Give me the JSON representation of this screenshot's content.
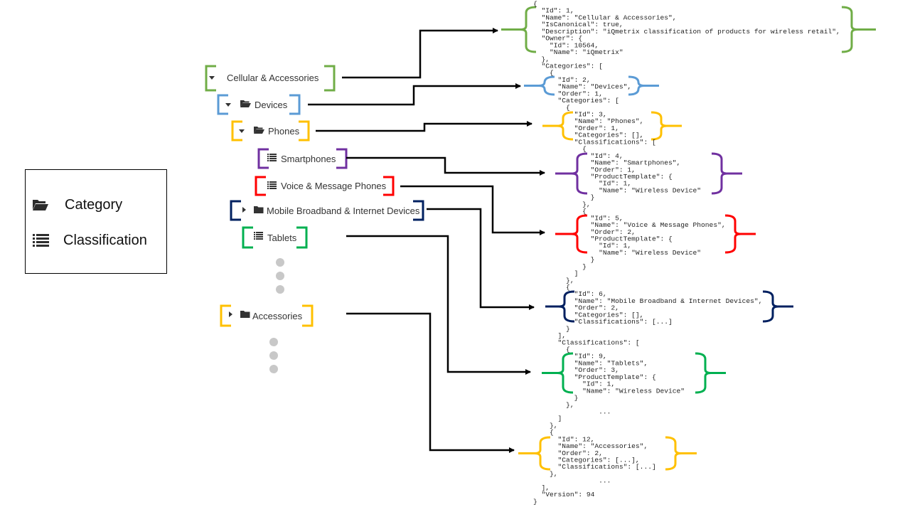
{
  "legend": {
    "items": [
      {
        "icon": "folder-open-icon",
        "label": "Category"
      },
      {
        "icon": "list-icon",
        "label": "Classification"
      }
    ]
  },
  "colors": {
    "cellular": "#70ad47",
    "devices": "#5b9bd5",
    "phones": "#ffc000",
    "smartphones": "#7030a0",
    "voice": "#ff0000",
    "mobile": "#002060",
    "tablets": "#00b050",
    "accessories": "#ffc000",
    "arrow": "#000000",
    "ellipsis_dots": "#c8c8c8"
  },
  "tree": {
    "nodes": [
      {
        "id": "cellular",
        "label": "Cellular & Accessories",
        "toggle": "expanded",
        "icon": "none",
        "color_key": "cellular"
      },
      {
        "id": "devices",
        "label": "Devices",
        "toggle": "expanded",
        "icon": "folder-open",
        "color_key": "devices"
      },
      {
        "id": "phones",
        "label": "Phones",
        "toggle": "expanded",
        "icon": "folder-open",
        "color_key": "phones"
      },
      {
        "id": "smartphones",
        "label": "Smartphones",
        "toggle": "none",
        "icon": "list",
        "color_key": "smartphones"
      },
      {
        "id": "voice",
        "label": "Voice & Message Phones",
        "toggle": "none",
        "icon": "list",
        "color_key": "voice"
      },
      {
        "id": "mobile",
        "label": "Mobile Broadband & Internet Devices",
        "toggle": "collapsed",
        "icon": "folder",
        "color_key": "mobile"
      },
      {
        "id": "tablets",
        "label": "Tablets",
        "toggle": "none",
        "icon": "list",
        "color_key": "tablets"
      },
      {
        "id": "accessories",
        "label": "Accessories",
        "toggle": "collapsed",
        "icon": "folder",
        "color_key": "accessories"
      }
    ]
  },
  "json_lines": [
    "{",
    "  \"Id\": 1,",
    "  \"Name\": \"Cellular & Accessories\",",
    "  \"IsCanonical\": true,",
    "  \"Description\": \"iQmetrix classification of products for wireless retail\",",
    "  \"Owner\": {",
    "    \"Id\": 10564,",
    "    \"Name\": \"iQmetrix\"",
    "  },",
    "  \"Categories\": [",
    "    {",
    "      \"Id\": 2,",
    "      \"Name\": \"Devices\",",
    "      \"Order\": 1,",
    "      \"Categories\": [",
    "        {",
    "          \"Id\": 3,",
    "          \"Name\": \"Phones\",",
    "          \"Order\": 1,",
    "          \"Categories\": [],",
    "          \"Classifications\": [",
    "            {",
    "              \"Id\": 4,",
    "              \"Name\": \"Smartphones\",",
    "              \"Order\": 1,",
    "              \"ProductTemplate\": {",
    "                \"Id\": 1,",
    "                \"Name\": \"Wireless Device\"",
    "              }",
    "            },",
    "            {",
    "              \"Id\": 5,",
    "              \"Name\": \"Voice & Message Phones\",",
    "              \"Order\": 2,",
    "              \"ProductTemplate\": {",
    "                \"Id\": 1,",
    "                \"Name\": \"Wireless Device\"",
    "              }",
    "            }",
    "          ]",
    "        },",
    "        {",
    "          \"Id\": 6,",
    "          \"Name\": \"Mobile Broadband & Internet Devices\",",
    "          \"Order\": 2,",
    "          \"Categories\": [],",
    "          \"Classifications\": [...]",
    "        }",
    "      ],",
    "      \"Classifications\": [",
    "        {",
    "          \"Id\": 9,",
    "          \"Name\": \"Tablets\",",
    "          \"Order\": 3,",
    "          \"ProductTemplate\": {",
    "            \"Id\": 1,",
    "            \"Name\": \"Wireless Device\"",
    "          }",
    "        },",
    "                ...",
    "      ]",
    "    },",
    "    {",
    "      \"Id\": 12,",
    "      \"Name\": \"Accessories\",",
    "      \"Order\": 2,",
    "      \"Categories\": [...],",
    "      \"Classifications\": [...]",
    "    },",
    "                ...",
    "  ],",
    "  \"Version\": 94",
    "}"
  ]
}
